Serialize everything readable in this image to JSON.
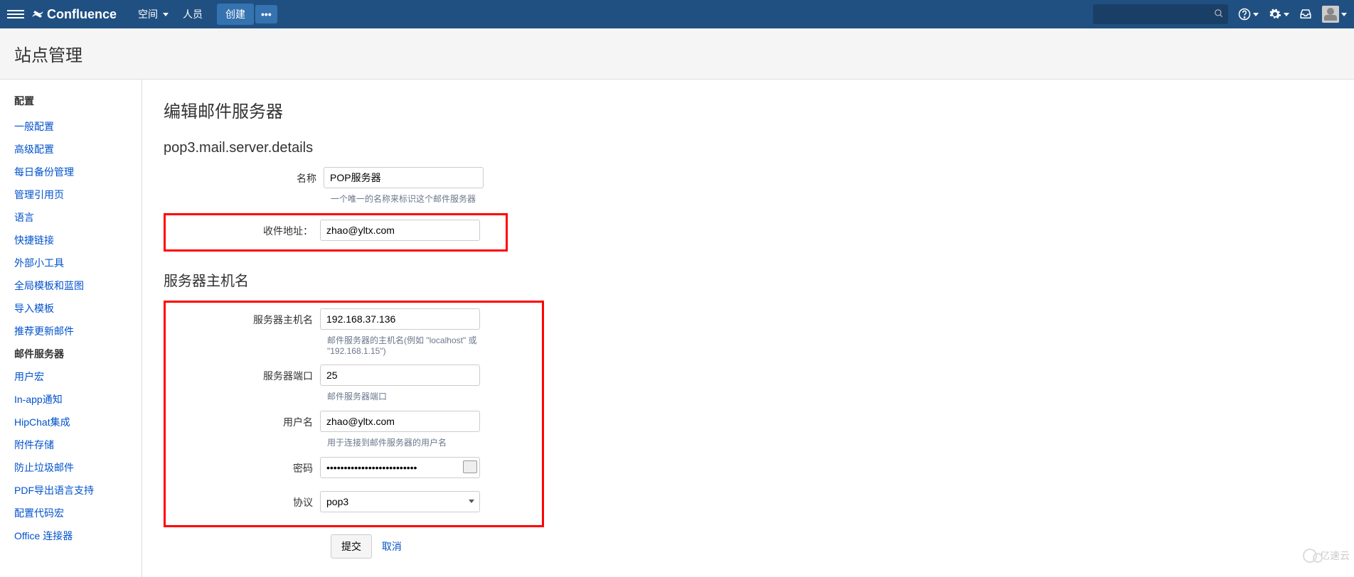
{
  "topbar": {
    "logo_text": "Confluence",
    "nav_space": "空间",
    "nav_people": "人员",
    "btn_create": "创建",
    "btn_more": "•••"
  },
  "page_title": "站点管理",
  "sidebar": {
    "group_config": "配置",
    "items": [
      "一般配置",
      "高级配置",
      "每日备份管理",
      "管理引用页",
      "语言",
      "快捷链接",
      "外部小工具",
      "全局模板和蓝图",
      "导入模板",
      "推荐更新邮件",
      "邮件服务器",
      "用户宏",
      "In-app通知",
      "HipChat集成",
      "附件存储",
      "防止垃圾邮件",
      "PDF导出语言支持",
      "配置代码宏",
      "Office 连接器"
    ],
    "active_index": 10
  },
  "content": {
    "heading": "编辑邮件服务器",
    "section1": "pop3.mail.server.details",
    "section2": "服务器主机名",
    "fields": {
      "name_label": "名称",
      "name_value": "POP服务器",
      "name_hint": "一个唯一的名称来标识这个邮件服务器",
      "addr_label": "收件地址：",
      "addr_value": "zhao@yltx.com",
      "host_label": "服务器主机名",
      "host_value": "192.168.37.136",
      "host_hint": "邮件服务器的主机名(例如 \"localhost\" 或 \"192.168.1.15\")",
      "port_label": "服务器端口",
      "port_value": "25",
      "port_hint": "邮件服务器端口",
      "user_label": "用户名",
      "user_value": "zhao@yltx.com",
      "user_hint": "用于连接到邮件服务器的用户名",
      "pwd_label": "密码",
      "pwd_value": "••••••••••••••••••••••••••",
      "proto_label": "协议",
      "proto_value": "pop3"
    },
    "btn_submit": "提交",
    "btn_cancel": "取消"
  },
  "watermark": "亿速云"
}
